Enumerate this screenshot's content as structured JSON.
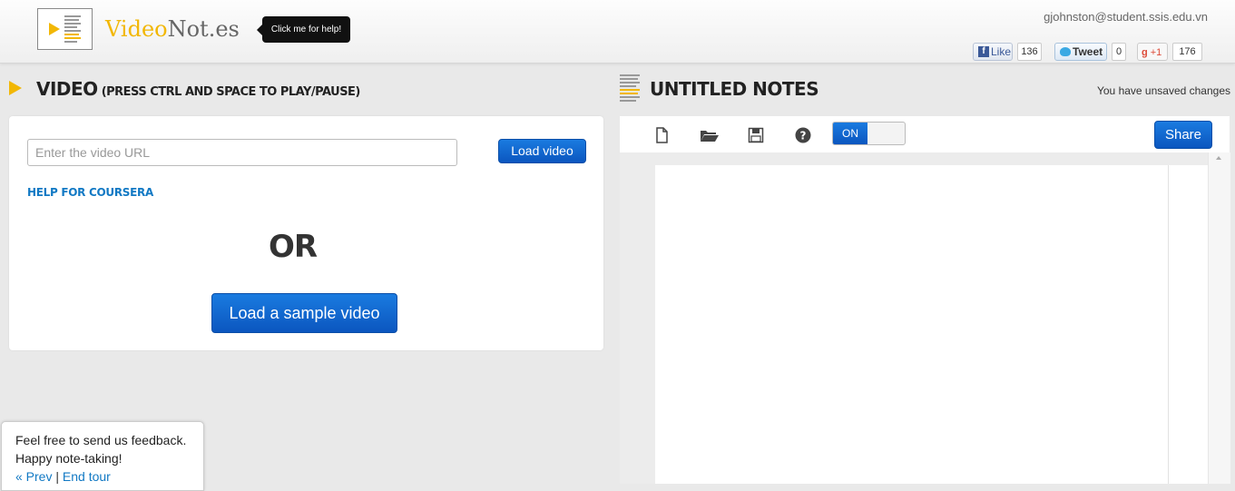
{
  "header": {
    "logo_part1": "Video",
    "logo_part2": "Not.es",
    "help_tooltip": "Click me for help!",
    "user_email": "gjohnston@student.ssis.edu.vn",
    "social": {
      "like_label": "Like",
      "like_count": "136",
      "tweet_label": "Tweet",
      "tweet_count": "0",
      "plus_label": "+1",
      "plus_count": "176"
    }
  },
  "video": {
    "heading": "VIDEO",
    "subheading": "(Press Ctrl and Space to play/pause)",
    "url_placeholder": "Enter the video URL",
    "load_button": "Load video",
    "help_link": "HELP FOR COURSERA",
    "or_text": "OR",
    "sample_button": "Load a sample video"
  },
  "notes": {
    "heading": "UNTITLED NOTES",
    "status": "You have unsaved changes",
    "toolbar": {
      "icons": [
        "new-file-icon",
        "open-folder-icon",
        "save-icon",
        "help-icon"
      ],
      "toggle_on_label": "ON"
    },
    "share_button": "Share"
  },
  "tour": {
    "line1": "Feel free to send us feedback.",
    "line2": "Happy note-taking!",
    "prev": "« Prev",
    "separator": " | ",
    "end": "End tour"
  },
  "colors": {
    "accent": "#f2b705",
    "button_blue": "#0b56bf",
    "link_blue": "#1279c4",
    "background": "#e9e9e9"
  }
}
